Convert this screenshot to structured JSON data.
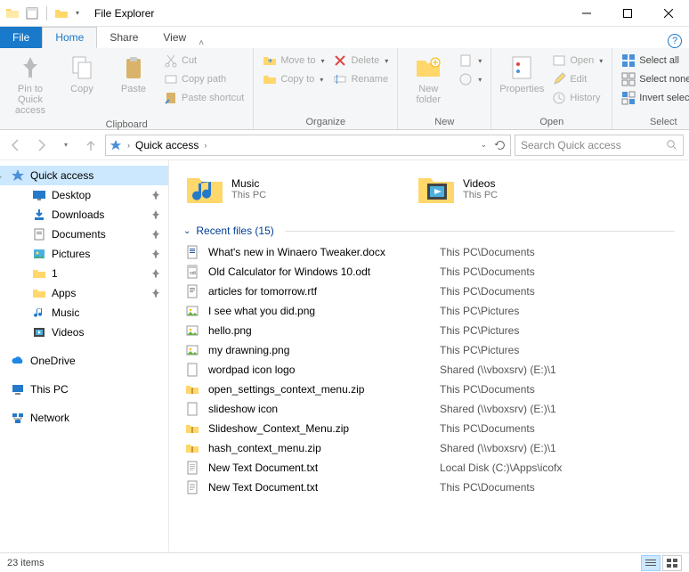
{
  "window": {
    "title": "File Explorer"
  },
  "tabs": {
    "file": "File",
    "home": "Home",
    "share": "Share",
    "view": "View"
  },
  "ribbon": {
    "clipboard": {
      "label": "Clipboard",
      "pin": "Pin to Quick access",
      "copy": "Copy",
      "paste": "Paste",
      "cut": "Cut",
      "copypath": "Copy path",
      "shortcut": "Paste shortcut"
    },
    "organize": {
      "label": "Organize",
      "moveto": "Move to",
      "copyto": "Copy to",
      "delete": "Delete",
      "rename": "Rename"
    },
    "new": {
      "label": "New",
      "newfolder": "New folder"
    },
    "open": {
      "label": "Open",
      "properties": "Properties",
      "open": "Open",
      "edit": "Edit",
      "history": "History"
    },
    "select": {
      "label": "Select",
      "all": "Select all",
      "none": "Select none",
      "invert": "Invert selection"
    }
  },
  "address": {
    "root": "Quick access",
    "search_placeholder": "Search Quick access"
  },
  "nav": {
    "quick": "Quick access",
    "desktop": "Desktop",
    "downloads": "Downloads",
    "documents": "Documents",
    "pictures": "Pictures",
    "one": "1",
    "apps": "Apps",
    "music": "Music",
    "videos": "Videos",
    "onedrive": "OneDrive",
    "thispc": "This PC",
    "network": "Network"
  },
  "folders": [
    {
      "name": "Music",
      "sub": "This PC"
    },
    {
      "name": "Videos",
      "sub": "This PC"
    }
  ],
  "recent_header": "Recent files (15)",
  "recent": [
    {
      "name": "What's new in Winaero Tweaker.docx",
      "loc": "This PC\\Documents",
      "icon": "doc"
    },
    {
      "name": "Old Calculator for Windows 10.odt",
      "loc": "This PC\\Documents",
      "icon": "odt"
    },
    {
      "name": "articles for tomorrow.rtf",
      "loc": "This PC\\Documents",
      "icon": "rtf"
    },
    {
      "name": "I see what you did.png",
      "loc": "This PC\\Pictures",
      "icon": "png"
    },
    {
      "name": "hello.png",
      "loc": "This PC\\Pictures",
      "icon": "png"
    },
    {
      "name": "my drawning.png",
      "loc": "This PC\\Pictures",
      "icon": "png"
    },
    {
      "name": "wordpad icon logo",
      "loc": "Shared (\\\\vboxsrv) (E:)\\1",
      "icon": "file"
    },
    {
      "name": "open_settings_context_menu.zip",
      "loc": "This PC\\Documents",
      "icon": "zip"
    },
    {
      "name": "slideshow icon",
      "loc": "Shared (\\\\vboxsrv) (E:)\\1",
      "icon": "file"
    },
    {
      "name": "Slideshow_Context_Menu.zip",
      "loc": "This PC\\Documents",
      "icon": "zip"
    },
    {
      "name": "hash_context_menu.zip",
      "loc": "Shared (\\\\vboxsrv) (E:)\\1",
      "icon": "zip"
    },
    {
      "name": "New Text Document.txt",
      "loc": "Local Disk (C:)\\Apps\\icofx",
      "icon": "txt"
    },
    {
      "name": "New Text Document.txt",
      "loc": "This PC\\Documents",
      "icon": "txt"
    }
  ],
  "status": {
    "items": "23 items"
  }
}
